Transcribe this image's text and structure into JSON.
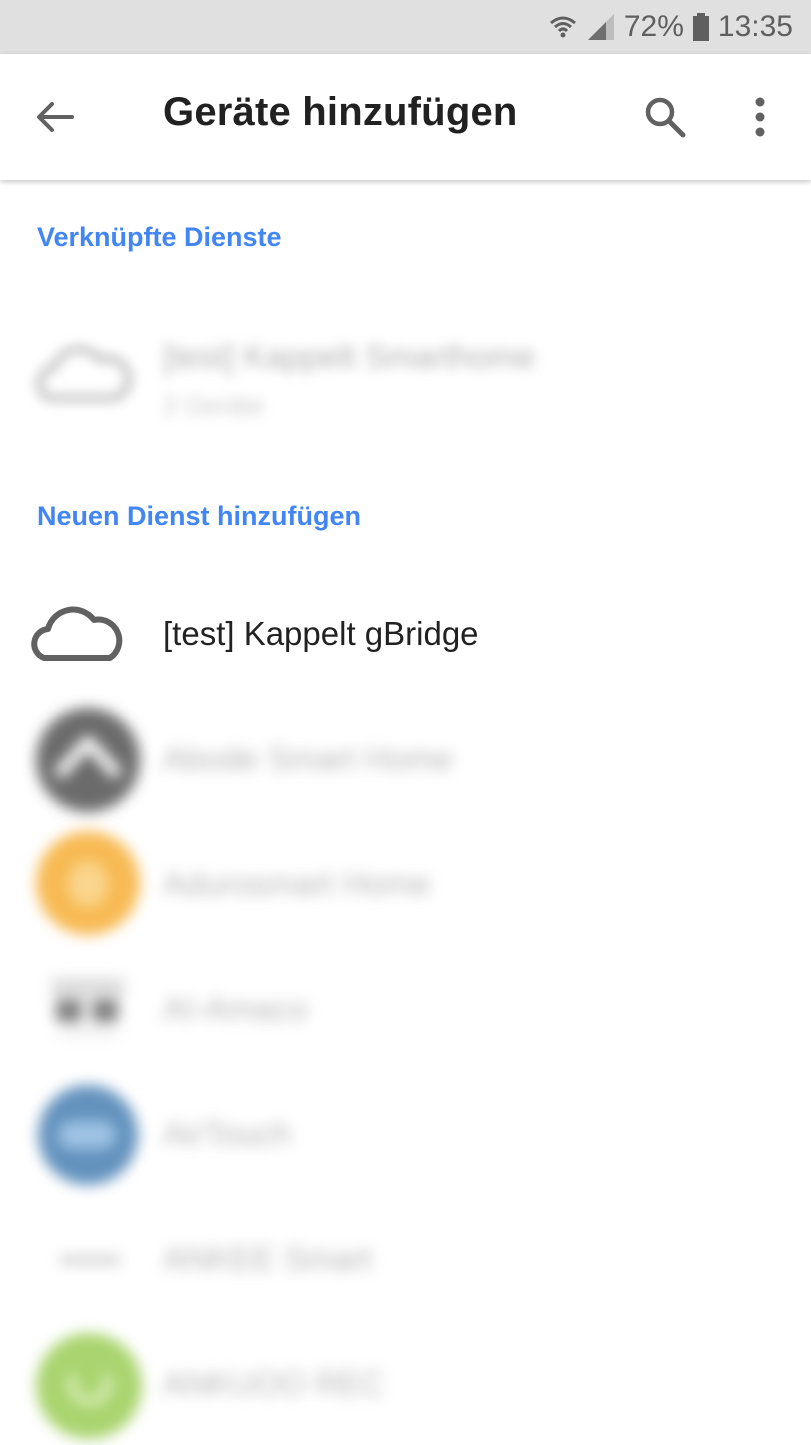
{
  "status_bar": {
    "battery_percent": "72%",
    "time": "13:35",
    "icons": [
      "wifi-icon",
      "signal-icon",
      "battery-icon"
    ]
  },
  "app_bar": {
    "title": "Geräte hinzufügen",
    "icons": [
      "back-arrow-icon",
      "search-icon",
      "more-vert-icon"
    ]
  },
  "linked_services": {
    "header": "Verknüpfte Dienste",
    "items": [
      {
        "name": "[test] Kappelt Smarthome",
        "subtitle": "2 Geräte",
        "icon": "cloud-icon"
      }
    ]
  },
  "new_services": {
    "header": "Neuen Dienst hinzufügen",
    "items": [
      {
        "name": "[test] Kappelt gBridge",
        "icon": "cloud-icon"
      },
      {
        "name": "Abode Smart Home",
        "icon": "abode-logo-icon",
        "color": "#3a3a3a"
      },
      {
        "name": "Adurosmart Home",
        "icon": "adurosmart-logo-icon",
        "color": "#f5a31a"
      },
      {
        "name": "AI-Amaco",
        "icon": "ai-amaco-logo-icon",
        "color": "#555555"
      },
      {
        "name": "AirTouch",
        "icon": "airtouch-logo-icon",
        "color": "#2f6ea8"
      },
      {
        "name": "ANKEE Smart",
        "icon": "ankee-logo-icon",
        "color": "#bbbbbb"
      },
      {
        "name": "ANKUOO REC",
        "icon": "ankuoo-logo-icon",
        "color": "#8dc63f"
      }
    ]
  },
  "colors": {
    "accent": "#4285f4",
    "status_bar_bg": "#e0e0e0",
    "text_primary": "#212121"
  }
}
